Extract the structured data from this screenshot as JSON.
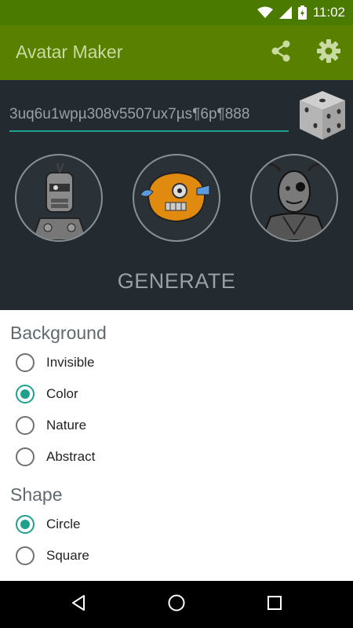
{
  "status_bar": {
    "time": "11:02",
    "icons": [
      "wifi-icon",
      "signal-icon",
      "battery-icon"
    ]
  },
  "app_bar": {
    "title": "Avatar Maker",
    "actions": [
      "share-icon",
      "settings-icon"
    ]
  },
  "seed": {
    "value": "3uq6u1wpµ308v5507ux7µs¶6p¶888"
  },
  "dice": {
    "icon": "dice-icon"
  },
  "avatars": [
    {
      "name": "robot-avatar"
    },
    {
      "name": "blob-avatar"
    },
    {
      "name": "alien-avatar"
    }
  ],
  "generate_label": "GENERATE",
  "background_section": {
    "title": "Background",
    "options": [
      {
        "label": "Invisible",
        "checked": false
      },
      {
        "label": "Color",
        "checked": true
      },
      {
        "label": "Nature",
        "checked": false
      },
      {
        "label": "Abstract",
        "checked": false
      }
    ]
  },
  "shape_section": {
    "title": "Shape",
    "options": [
      {
        "label": "Circle",
        "checked": true
      },
      {
        "label": "Square",
        "checked": false
      }
    ]
  },
  "nav_bar": {
    "buttons": [
      "back-icon",
      "home-icon",
      "recents-icon"
    ]
  },
  "colors": {
    "status_bar": "#4a7a00",
    "app_bar": "#5a8000",
    "accent": "#1fa08d",
    "panel": "#232a30"
  }
}
